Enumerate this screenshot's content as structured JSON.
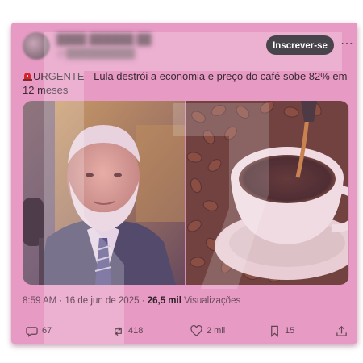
{
  "post": {
    "author_name": "████ ██████ ██",
    "author_handle": "@██████████",
    "subscribe_label": "Inscrever-se",
    "more_label": "⋯",
    "text": "URGENTE - Lula destrói a economia e preço do café sobe 82% em 12 meses",
    "timestamp": "8:59 AM · 16 de jun de 2025 · ",
    "views_count": "26,5 mil",
    "views_label": " Visualizações"
  },
  "actions": {
    "replies": "67",
    "reposts": "418",
    "likes": "2 mil",
    "bookmarks": "15"
  },
  "icons": {
    "emoji": "siren-icon",
    "reply": "comment-icon",
    "repost": "repost-icon",
    "like": "heart-icon",
    "bookmark": "bookmark-icon",
    "share": "share-icon"
  },
  "colors": {
    "overlay_tint": "#e79ac4",
    "button_bg": "#14101a",
    "text": "#3b2a33",
    "siren": "#d4232c"
  }
}
